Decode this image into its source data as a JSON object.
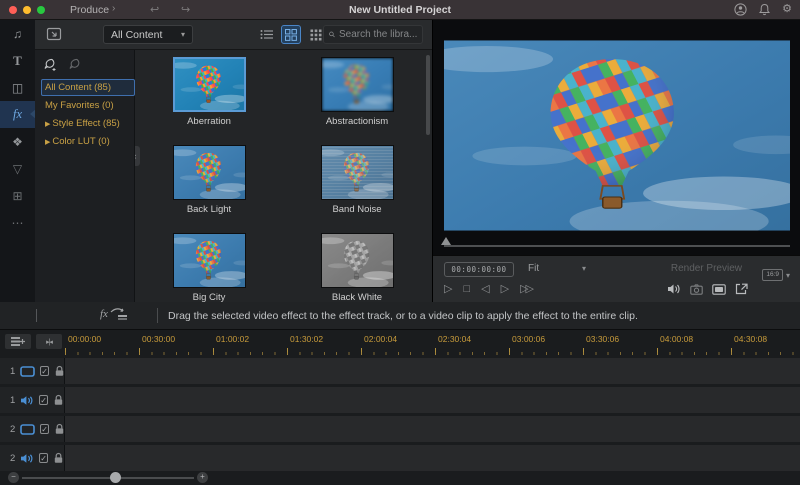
{
  "window": {
    "title": "New Untitled Project",
    "menu_label": "Produce",
    "menu_chevron": "›",
    "undo_glyph": "↩",
    "redo_glyph": "↪",
    "traffic_lights": [
      "#ff5f57",
      "#febc2e",
      "#28c840"
    ],
    "right_icons": [
      "account-icon",
      "notifications-icon",
      "settings-icon"
    ]
  },
  "rail": {
    "items": [
      {
        "name": "media",
        "glyph": "♫",
        "selected": false
      },
      {
        "name": "titles",
        "glyph": "T",
        "selected": false
      },
      {
        "name": "transitions",
        "glyph": "◫",
        "selected": false
      },
      {
        "name": "effects",
        "glyph": "fx",
        "selected": true
      },
      {
        "name": "elements",
        "glyph": "❖",
        "selected": false
      },
      {
        "name": "split-screen",
        "glyph": "▽",
        "selected": false
      },
      {
        "name": "screen-record",
        "glyph": "⊞",
        "selected": false
      },
      {
        "name": "more",
        "glyph": "⋯",
        "selected": false
      }
    ]
  },
  "categories": {
    "items": [
      {
        "label": "All Content (85)",
        "selected": true,
        "expandable": false
      },
      {
        "label": "My Favorites (0)",
        "selected": false,
        "expandable": false
      },
      {
        "label": "Style Effect (85)",
        "selected": false,
        "expandable": true
      },
      {
        "label": "Color LUT (0)",
        "selected": false,
        "expandable": true
      }
    ]
  },
  "browser_toolbar": {
    "filter_value": "All Content",
    "search_placeholder": "Search the libra...",
    "view_modes": [
      "list-view-icon",
      "grid-view-icon",
      "small-grid-view-icon"
    ],
    "selected_view": "grid-view-icon"
  },
  "effects": [
    {
      "name": "Aberration",
      "variant": "aberration",
      "selected": true
    },
    {
      "name": "Abstractionism",
      "variant": "blur",
      "selected": false
    },
    {
      "name": "Back Light",
      "variant": "normal",
      "selected": false
    },
    {
      "name": "Band Noise",
      "variant": "noise",
      "selected": false
    },
    {
      "name": "Big City",
      "variant": "normal",
      "selected": false
    },
    {
      "name": "Black White",
      "variant": "grayscale",
      "selected": false
    }
  ],
  "preview": {
    "timecode": "00:00:00:00",
    "fit_label": "Fit",
    "render_preview_label": "Render Preview",
    "aspect_label": "16:9",
    "transport": [
      "play",
      "stop",
      "step-back",
      "step-forward",
      "fast-forward"
    ],
    "right_icons": [
      "volume-icon",
      "snapshot-icon",
      "display-mode-icon",
      "fullscreen-icon"
    ]
  },
  "hint_text": "Drag the selected video effect to the effect track, or to a video clip to apply the effect to the entire clip.",
  "timeline": {
    "ruler_labels": [
      "00:00:00",
      "00:30:00",
      "01:00:02",
      "01:30:02",
      "02:00:04",
      "02:30:04",
      "03:00:06",
      "03:30:06",
      "04:00:08",
      "04:30:08"
    ],
    "tracks": [
      {
        "number": "1",
        "type": "video"
      },
      {
        "number": "1",
        "type": "audio"
      },
      {
        "number": "2",
        "type": "video"
      },
      {
        "number": "2",
        "type": "audio"
      }
    ],
    "snap_glyph": "▸|◂"
  },
  "colors": {
    "accent_blue": "#4a8fd4",
    "selection_border": "#5b9bd5",
    "gold_text": "#c9a145",
    "ruler_gold": "#c79b3b"
  }
}
